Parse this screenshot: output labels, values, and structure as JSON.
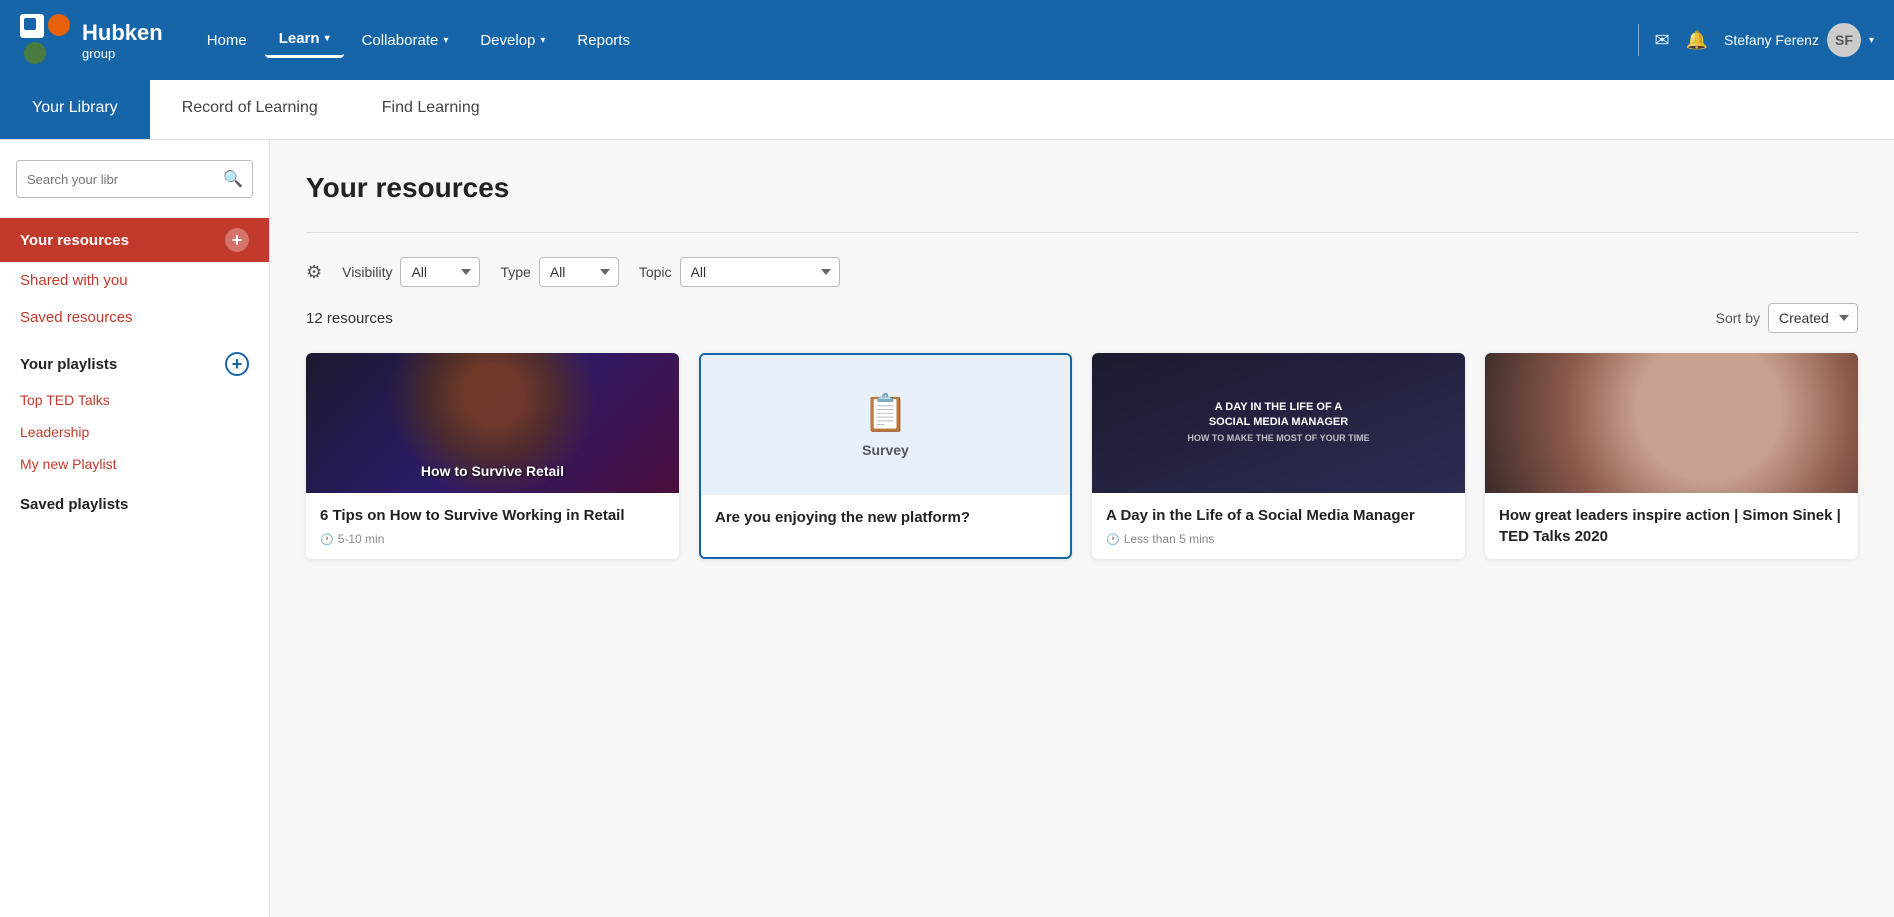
{
  "header": {
    "brand": "Hubken",
    "sub": "group",
    "nav": [
      {
        "label": "Home",
        "active": false,
        "hasDropdown": false
      },
      {
        "label": "Learn",
        "active": true,
        "hasDropdown": true
      },
      {
        "label": "Collaborate",
        "active": false,
        "hasDropdown": true
      },
      {
        "label": "Develop",
        "active": false,
        "hasDropdown": true
      },
      {
        "label": "Reports",
        "active": false,
        "hasDropdown": false
      }
    ],
    "user": "Stefany Ferenz"
  },
  "tabs": [
    {
      "label": "Your Library",
      "active": true
    },
    {
      "label": "Record of Learning",
      "active": false
    },
    {
      "label": "Find Learning",
      "active": false
    }
  ],
  "sidebar": {
    "search_placeholder": "Search your libr",
    "items": [
      {
        "label": "Your resources",
        "active": true
      },
      {
        "label": "Shared with you",
        "active": false
      },
      {
        "label": "Saved resources",
        "active": false
      }
    ],
    "playlists_section": "Your playlists",
    "playlists": [
      {
        "label": "Top TED Talks"
      },
      {
        "label": "Leadership"
      },
      {
        "label": "My new Playlist"
      }
    ],
    "saved_playlists_section": "Saved playlists"
  },
  "content": {
    "title": "Your resources",
    "filters": {
      "visibility_label": "Visibility",
      "visibility_value": "All",
      "type_label": "Type",
      "type_value": "All",
      "topic_label": "Topic",
      "topic_value": "All"
    },
    "resource_count": "12 resources",
    "sort_label": "Sort by",
    "sort_value": "Created",
    "cards": [
      {
        "type": "video",
        "title": "6 Tips on How to Survive Working in Retail",
        "meta": "5-10 min",
        "highlighted": false,
        "img_type": "retail"
      },
      {
        "type": "survey",
        "type_label": "Survey",
        "title": "Are you enjoying the new platform?",
        "meta": "",
        "highlighted": true,
        "img_type": "survey"
      },
      {
        "type": "video",
        "title": "A Day in the Life of a Social Media Manager",
        "meta": "Less than 5 mins",
        "highlighted": false,
        "img_type": "social"
      },
      {
        "type": "video",
        "title": "How great leaders inspire action | Simon Sinek | TED Talks 2020",
        "meta": "",
        "highlighted": false,
        "img_type": "ted"
      }
    ]
  }
}
